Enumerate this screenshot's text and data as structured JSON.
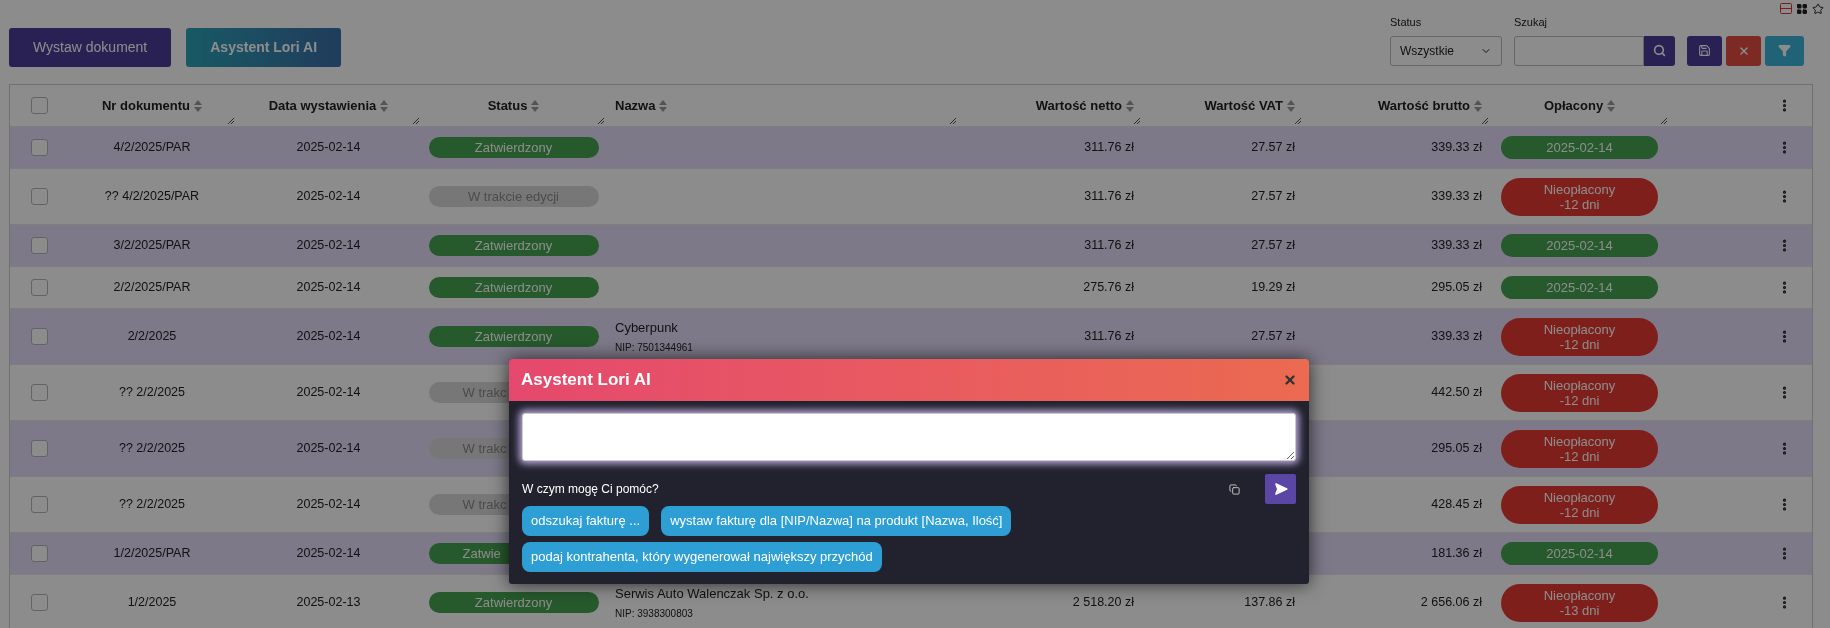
{
  "toolbar": {
    "buttons": [
      {
        "label": "Wystaw dokument",
        "kind": "primary"
      },
      {
        "label": "Asystent Lori AI",
        "kind": "ai"
      }
    ]
  },
  "filters": {
    "status": {
      "label": "Status",
      "value": "Wszystkie"
    },
    "search": {
      "label": "Szukaj"
    }
  },
  "table": {
    "header_checked": false,
    "columns": [
      "Nr dokumentu",
      "Data wystawienia",
      "Status",
      "Nazwa",
      "Wartość netto",
      "Wartość VAT",
      "Wartość brutto",
      "Opłacony"
    ],
    "rows": [
      {
        "checked": false,
        "number": "4/2/2025/PAR",
        "date": "2025-02-14",
        "status": {
          "label": "Zatwierdzony",
          "kind": "approved",
          "covered": false
        },
        "net": "311.76 zł",
        "vat": "27.57 zł",
        "gross": "339.33 zł",
        "paid": {
          "kind": "paid",
          "lines": [
            "2025-02-14"
          ]
        }
      },
      {
        "checked": false,
        "number": "?? 4/2/2025/PAR",
        "date": "2025-02-14",
        "status": {
          "label": "W trakcie edycji",
          "kind": "draft",
          "covered": false
        },
        "net": "311.76 zł",
        "vat": "27.57 zł",
        "gross": "339.33 zł",
        "paid": {
          "kind": "unpaid",
          "lines": [
            "Nieopłacony",
            "-12 dni"
          ]
        }
      },
      {
        "checked": false,
        "number": "3/2/2025/PAR",
        "date": "2025-02-14",
        "status": {
          "label": "Zatwierdzony",
          "kind": "approved",
          "covered": false
        },
        "net": "311.76 zł",
        "vat": "27.57 zł",
        "gross": "339.33 zł",
        "paid": {
          "kind": "paid",
          "lines": [
            "2025-02-14"
          ]
        }
      },
      {
        "checked": false,
        "number": "2/2/2025/PAR",
        "date": "2025-02-14",
        "status": {
          "label": "Zatwierdzony",
          "kind": "approved",
          "covered": false
        },
        "net": "275.76 zł",
        "vat": "19.29 zł",
        "gross": "295.05 zł",
        "paid": {
          "kind": "paid",
          "lines": [
            "2025-02-14"
          ]
        }
      },
      {
        "checked": false,
        "number": "2/2/2025",
        "date": "2025-02-14",
        "status": {
          "label": "Zatwierdzony",
          "kind": "approved",
          "covered": false
        },
        "name": "Cyberpunk",
        "nip": "NIP: 7501344961",
        "net": "311.76 zł",
        "vat": "27.57 zł",
        "gross": "339.33 zł",
        "paid": {
          "kind": "unpaid",
          "lines": [
            "Nieopłacony",
            "-12 dni"
          ]
        }
      },
      {
        "checked": false,
        "number": "?? 2/2/2025",
        "date": "2025-02-14",
        "status": {
          "label": "W trakc",
          "kind": "draft",
          "covered": true
        },
        "gross": "442.50 zł",
        "paid": {
          "kind": "unpaid",
          "lines": [
            "Nieopłacony",
            "-12 dni"
          ]
        }
      },
      {
        "checked": false,
        "number": "?? 2/2/2025",
        "date": "2025-02-14",
        "status": {
          "label": "W trakc",
          "kind": "draft",
          "covered": true
        },
        "gross": "295.05 zł",
        "paid": {
          "kind": "unpaid",
          "lines": [
            "Nieopłacony",
            "-12 dni"
          ]
        }
      },
      {
        "checked": false,
        "number": "?? 2/2/2025",
        "date": "2025-02-14",
        "status": {
          "label": "W trakc",
          "kind": "draft",
          "covered": true
        },
        "gross": "428.45 zł",
        "paid": {
          "kind": "unpaid",
          "lines": [
            "Nieopłacony",
            "-12 dni"
          ]
        }
      },
      {
        "checked": false,
        "number": "1/2/2025/PAR",
        "date": "2025-02-14",
        "status": {
          "label": "Zatwie",
          "kind": "approved",
          "covered": true
        },
        "gross": "181.36 zł",
        "paid": {
          "kind": "paid",
          "lines": [
            "2025-02-14"
          ]
        }
      },
      {
        "checked": false,
        "number": "1/2/2025",
        "date": "2025-02-13",
        "status": {
          "label": "Zatwierdzony",
          "kind": "approved",
          "covered": false
        },
        "name": "Serwis Auto Walenczak Sp. z o.o.",
        "nip": "NIP: 3938300803",
        "net": "2 518.20 zł",
        "vat": "137.86 zł",
        "gross": "2 656.06 zł",
        "paid": {
          "kind": "unpaid",
          "lines": [
            "Nieopłacony",
            "-13 dni"
          ]
        }
      }
    ]
  },
  "dialog": {
    "title": "Asystent Lori AI",
    "prompt": "W czym mogę Ci pomóc?",
    "suggestions": [
      "odszukaj fakturę ...",
      "wystaw fakturę dla [NIP/Nazwa] na produkt [Nazwa, Ilość]",
      "podaj kontrahenta, który wygenerował największy przychód"
    ]
  }
}
